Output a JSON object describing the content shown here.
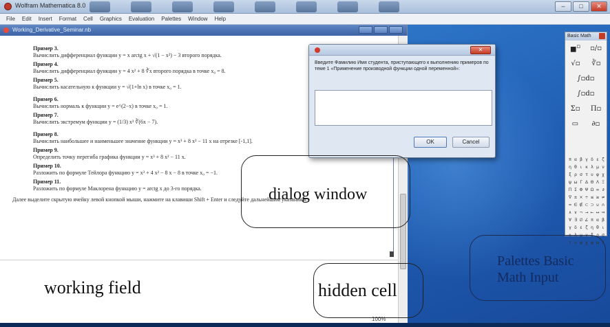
{
  "app": {
    "title": "Wolfram Mathematica 8.0"
  },
  "menu": [
    "File",
    "Edit",
    "Insert",
    "Format",
    "Cell",
    "Graphics",
    "Evaluation",
    "Palettes",
    "Window",
    "Help"
  ],
  "notebook": {
    "title": "Working_Derivative_Seminar.nb",
    "examples": [
      {
        "heading": "Пример 3.",
        "text": "Вычислить дифференциал функции y = x arctg x + √(1 − x²) − 3 второго порядка."
      },
      {
        "heading": "Пример 4.",
        "text": "Вычислить дифференциал функции y = 4 x² + 8 ∛x второго порядка в точке x₀ = 8."
      },
      {
        "heading": "Пример 5.",
        "text": "Вычислить касательную к функции y = √(1+ln x) в точке x₀ = 1."
      },
      {
        "heading": "Пример 6.",
        "text": "Вычислить нормаль к функции y = e^(2−x) в точке x₀ = 1."
      },
      {
        "heading": "Пример 7.",
        "text": "Вычислить экстремум функции y = (1/3) x³ ∛(6x − 7)."
      },
      {
        "heading": "Пример 8.",
        "text": "Вычислить наибольшее и наименьшее значение функции y = x³ + 8 x² − 11 x на отрезке [-1,1]."
      },
      {
        "heading": "Пример 9.",
        "text": "Определить точку перегиба графика функции y = x³ + 8 x² − 11 x."
      },
      {
        "heading": "Пример 10.",
        "text": "Разложить по формуле Тейлора функцию y = x³ + 4 x² − 8 x − 8 в точке x₀ = −1."
      },
      {
        "heading": "Пример 11.",
        "text": "Разложить по формуле Маклорена функцию y = arctg x до 3-го порядка."
      }
    ],
    "footer": "Далее выделите скрытую ячейку левой кнопкой мыши, нажмите на клавиши Shift + Enter и следуйте дальнейшим указаниям.",
    "zoom": "100%"
  },
  "dialog": {
    "prompt": "Введите Фамилию Имя студента, приступающего к выполнению примеров по теме 1 «Применение производной функции одной переменной»:",
    "input_value": "",
    "ok_label": "OK",
    "cancel_label": "Cancel"
  },
  "palette": {
    "title": "Basic Math"
  },
  "annotations": {
    "dialog_window": "dialog window",
    "hidden_cell": "hidden cell",
    "palettes": "Palettes Basic Math Input",
    "working_field": "working field"
  },
  "colors": {
    "desktop_blue": "#1f5db3",
    "dialog_bg": "#dfe7f2",
    "palette_label": "#132a5e"
  }
}
